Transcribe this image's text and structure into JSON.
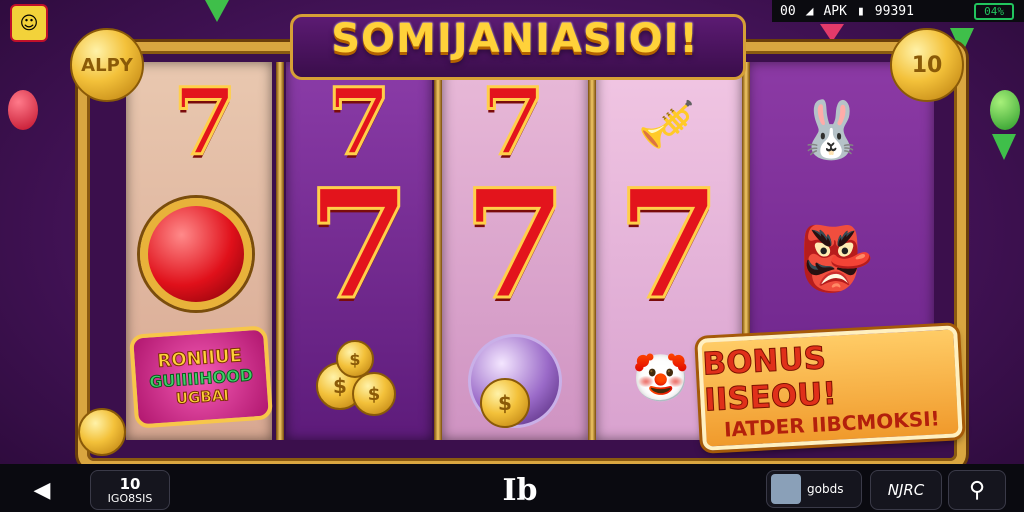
{
  "status_bar": {
    "left": "00",
    "app": "APK",
    "center": "99391",
    "battery": "04%"
  },
  "banner": {
    "title": "SOMIJANIASIOI!"
  },
  "corner_badges": {
    "left": "ALPY",
    "right": "10"
  },
  "reels": {
    "reel1": [
      "7",
      "red-gem-icon",
      "bonus-badge"
    ],
    "reel2": [
      "7",
      "7",
      "gold-coins-icon"
    ],
    "reel3": [
      "7",
      "7",
      "crystal-ball-icon"
    ],
    "reel4": [
      "jester-horn-icon",
      "7",
      "jester-coins-icon"
    ],
    "reel5": [
      "bunny-jester-icon",
      "goblin-jester-icon"
    ]
  },
  "reel_bonus_badge": {
    "line1": "RONIIUE",
    "line2": "GUIIIIHOOD",
    "line3": "UGBAI"
  },
  "bonus_panel": {
    "line1": "BONUS IISEOU!",
    "line2": "IATDER IIBCMOKSI!"
  },
  "bottom_nav": {
    "counter_value": "10",
    "counter_label": "IGO8SIS",
    "center_logo": "Ib",
    "profile_label": "gobds",
    "nav_text": "NJRC"
  },
  "colors": {
    "gold": "#d9a640",
    "purple": "#4a1560",
    "seven_red": "#e3141c",
    "battery_green": "#22c55e"
  }
}
